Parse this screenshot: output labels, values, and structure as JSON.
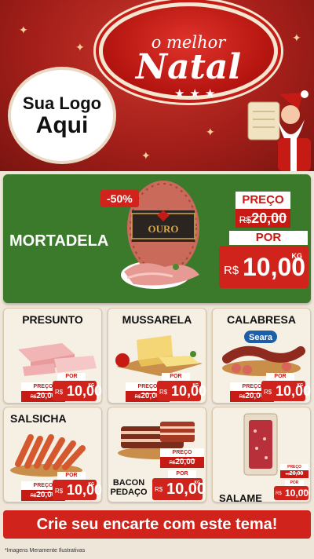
{
  "header": {
    "logo_line1": "Sua Logo",
    "logo_line2": "Aqui",
    "theme_small": "o melhor",
    "theme_big": "Natal"
  },
  "highlight": {
    "name": "MORTADELA",
    "discount": "-50%",
    "brand": "OURO",
    "price_label": "PREÇO",
    "old_currency": "R$",
    "old_price": "20,00",
    "por_label": "POR",
    "currency": "R$",
    "new_price": "10,00",
    "unit": "KG"
  },
  "products": [
    {
      "name": "PRESUNTO",
      "price_label": "PREÇO",
      "old_currency": "R$",
      "old_price": "20,00",
      "por_label": "POR",
      "currency": "R$",
      "new_price": "10,00",
      "unit": "KG"
    },
    {
      "name": "MUSSARELA",
      "price_label": "PREÇO",
      "old_currency": "R$",
      "old_price": "20,00",
      "por_label": "POR",
      "currency": "R$",
      "new_price": "10,00",
      "unit": "KG"
    },
    {
      "name": "CALABRESA",
      "brand": "Seara",
      "price_label": "PREÇO",
      "old_currency": "R$",
      "old_price": "20,00",
      "por_label": "POR",
      "currency": "R$",
      "new_price": "10,00",
      "unit": "KG"
    },
    {
      "name": "SALSICHA",
      "price_label": "PREÇO",
      "old_currency": "R$",
      "old_price": "20,00",
      "por_label": "POR",
      "currency": "R$",
      "new_price": "10,00",
      "unit": "KG"
    },
    {
      "name": "BACON\nPEDAÇO",
      "price_label": "PREÇO",
      "old_currency": "R$",
      "old_price": "20,00",
      "por_label": "POR",
      "currency": "R$",
      "new_price": "10,00",
      "unit": "KG"
    },
    {
      "name": "SALAME",
      "price_label": "PREÇO",
      "old_currency": "R$",
      "old_price": "20,00",
      "por_label": "POR",
      "currency": "R$",
      "new_price": "10,00",
      "unit": "KG"
    }
  ],
  "footer": {
    "banner": "Crie seu encarte com este tema!",
    "disclaimer": "*Imagens Meramente Ilustrativas"
  },
  "colors": {
    "header_red": "#a51f1a",
    "hero_green": "#3a7a2a",
    "price_red": "#d0231b",
    "card_bg": "#f6efe4"
  }
}
